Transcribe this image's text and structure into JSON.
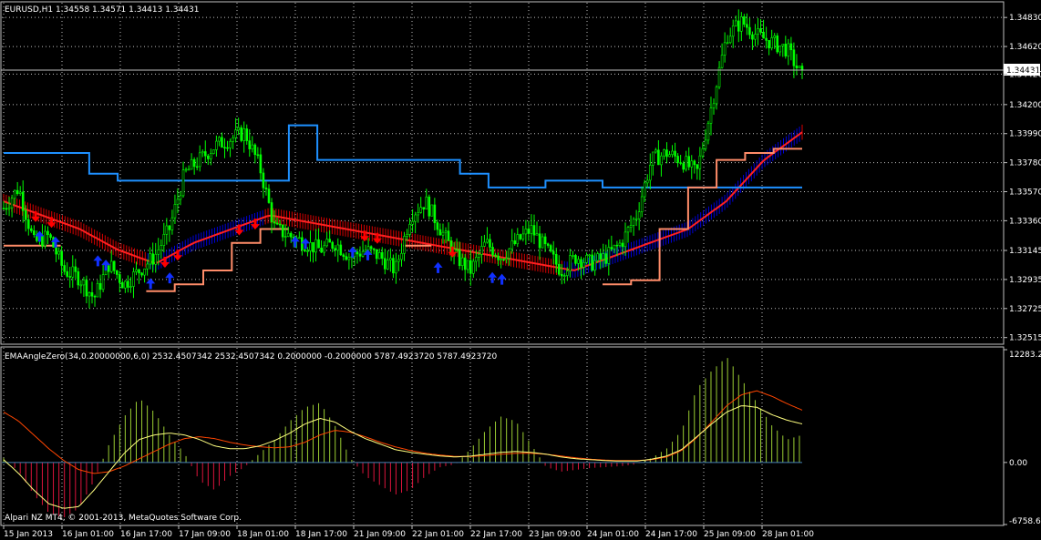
{
  "window": {
    "symbol_header": "EURUSD,H1  1.34558 1.34571 1.34413 1.34431",
    "indicator_header": "EMAAngleZero(34,0.20000000,6,0) 2532.4507342 2532.4507342 0.2000000 -0.2000000 5787.4923720 5787.4923720",
    "copyright": "Alpari NZ MT4, © 2001-2013, MetaQuotes Software Corp."
  },
  "colors": {
    "background": "#000000",
    "grid": "#c0c0c0",
    "candles": "#00ff00",
    "upper_band": "#1e90ff",
    "lower_band": "#ff8c69",
    "ribbon_down": "#ff0000",
    "ribbon_up": "#0000ff",
    "histogram_pos": "#9acd32",
    "histogram_neg": "#dc143c",
    "ema_line": "#ffff80",
    "signal_line": "#ff4500",
    "zero_line": "#4682b4"
  },
  "chart_data": [
    {
      "type": "candlestick",
      "title": "EURUSD,H1",
      "ohlc_current": {
        "open": 1.34558,
        "high": 1.34571,
        "low": 1.34413,
        "close": 1.34431
      },
      "current_price_label": "1.34431",
      "y_ticks": [
        "1.34830",
        "1.34620",
        "1.34420",
        "1.34200",
        "1.33990",
        "1.33780",
        "1.33570",
        "1.33360",
        "1.33145",
        "1.32935",
        "1.32725",
        "1.32515"
      ],
      "ylim": [
        1.3248,
        1.3493
      ],
      "x_ticks": [
        "15 Jan 2013",
        "16 Jan 01:00",
        "16 Jan 17:00",
        "17 Jan 09:00",
        "18 Jan 01:00",
        "18 Jan 17:00",
        "21 Jan 09:00",
        "22 Jan 01:00",
        "22 Jan 17:00",
        "23 Jan 09:00",
        "24 Jan 01:00",
        "24 Jan 17:00",
        "25 Jan 09:00",
        "28 Jan 01:00"
      ],
      "close_path": [
        1.3345,
        1.336,
        1.332,
        1.3325,
        1.33,
        1.3295,
        1.328,
        1.3305,
        1.329,
        1.33,
        1.331,
        1.333,
        1.337,
        1.338,
        1.339,
        1.3395,
        1.34,
        1.3375,
        1.333,
        1.3325,
        1.332,
        1.3315,
        1.332,
        1.331,
        1.3315,
        1.331,
        1.33,
        1.334,
        1.335,
        1.333,
        1.331,
        1.33,
        1.332,
        1.331,
        1.332,
        1.333,
        1.3315,
        1.33,
        1.331,
        1.3305,
        1.331,
        1.332,
        1.334,
        1.338,
        1.3385,
        1.338,
        1.337,
        1.342,
        1.347,
        1.348,
        1.347,
        1.3465,
        1.346,
        1.344
      ],
      "upper_band": [
        1.3385,
        1.3385,
        1.3385,
        1.337,
        1.3365,
        1.3365,
        1.3365,
        1.3365,
        1.3365,
        1.3365,
        1.3405,
        1.338,
        1.338,
        1.338,
        1.338,
        1.338,
        1.337,
        1.336,
        1.336,
        1.3365,
        1.3365,
        1.336,
        1.336,
        1.336,
        1.336,
        1.336,
        1.336,
        1.336
      ],
      "lower_band": [
        1.3318,
        1.3318,
        null,
        null,
        null,
        1.3285,
        1.329,
        1.33,
        1.332,
        1.333,
        null,
        null,
        null,
        null,
        1.3318,
        null,
        null,
        null,
        null,
        null,
        null,
        1.329,
        1.3293,
        1.333,
        1.336,
        1.338,
        1.3385,
        1.3388
      ],
      "ribbon_mid": [
        1.335,
        1.334,
        1.333,
        1.3315,
        1.3305,
        1.332,
        1.333,
        1.334,
        1.3335,
        1.333,
        1.3325,
        1.332,
        1.3315,
        1.331,
        1.3305,
        1.33,
        1.331,
        1.332,
        1.333,
        1.335,
        1.338,
        1.34
      ],
      "arrows": [
        {
          "type": "down",
          "t": 0.04
        },
        {
          "type": "down",
          "t": 0.06
        },
        {
          "type": "up",
          "t": 0.045
        },
        {
          "type": "up",
          "t": 0.065
        },
        {
          "type": "up",
          "t": 0.118
        },
        {
          "type": "up",
          "t": 0.128
        },
        {
          "type": "up",
          "t": 0.184
        },
        {
          "type": "down",
          "t": 0.202
        },
        {
          "type": "up",
          "t": 0.208
        },
        {
          "type": "down",
          "t": 0.218
        },
        {
          "type": "down",
          "t": 0.295
        },
        {
          "type": "down",
          "t": 0.315
        },
        {
          "type": "up",
          "t": 0.365
        },
        {
          "type": "up",
          "t": 0.378
        },
        {
          "type": "up",
          "t": 0.437
        },
        {
          "type": "down",
          "t": 0.452
        },
        {
          "type": "up",
          "t": 0.456
        },
        {
          "type": "down",
          "t": 0.468
        },
        {
          "type": "up",
          "t": 0.544
        },
        {
          "type": "down",
          "t": 0.562
        },
        {
          "type": "up",
          "t": 0.612
        },
        {
          "type": "up",
          "t": 0.624
        }
      ]
    },
    {
      "type": "bar",
      "title": "EMAAngleZero(34,0.20000000,6,0)",
      "y_ticks": [
        "12283.25",
        "0.00",
        "-6758.61"
      ],
      "ylim": [
        -6758.61,
        12283.25
      ],
      "histogram": [
        500,
        -1000,
        -3500,
        -5500,
        -6000,
        -5000,
        -2000,
        2000,
        5000,
        7000,
        5500,
        3000,
        1000,
        -2000,
        -3000,
        -1500,
        -500,
        1000,
        2500,
        4500,
        6000,
        6500,
        4000,
        500,
        -1500,
        -2500,
        -3500,
        -3000,
        -1500,
        -500,
        -200,
        1500,
        3500,
        5000,
        4500,
        2000,
        -500,
        -1000,
        -800,
        -600,
        -500,
        -400,
        -200,
        500,
        1500,
        3500,
        8000,
        10000,
        11500,
        9000,
        6500,
        4000,
        2500,
        3000
      ],
      "ema_line": [
        300,
        -1200,
        -3000,
        -4500,
        -5000,
        -4800,
        -3000,
        -1000,
        1000,
        2500,
        3000,
        3200,
        3000,
        2500,
        1800,
        1500,
        1500,
        1800,
        2400,
        3200,
        4200,
        4800,
        4400,
        3400,
        2600,
        2000,
        1400,
        1100,
        900,
        700,
        600,
        700,
        900,
        1100,
        1200,
        1100,
        900,
        600,
        400,
        300,
        200,
        150,
        150,
        350,
        700,
        1400,
        2800,
        4200,
        5500,
        6200,
        6000,
        5200,
        4600,
        4200
      ],
      "signal_line": [
        5500,
        4500,
        3000,
        1500,
        200,
        -800,
        -1200,
        -1000,
        -400,
        400,
        1200,
        2000,
        2600,
        2800,
        2600,
        2200,
        1900,
        1700,
        1600,
        1700,
        2200,
        3000,
        3500,
        3300,
        2800,
        2200,
        1700,
        1300,
        1000,
        800,
        650,
        650,
        750,
        900,
        1000,
        1000,
        900,
        700,
        500,
        350,
        250,
        200,
        200,
        300,
        600,
        1300,
        2700,
        4400,
        6200,
        7400,
        7800,
        7200,
        6400,
        5700
      ]
    }
  ]
}
